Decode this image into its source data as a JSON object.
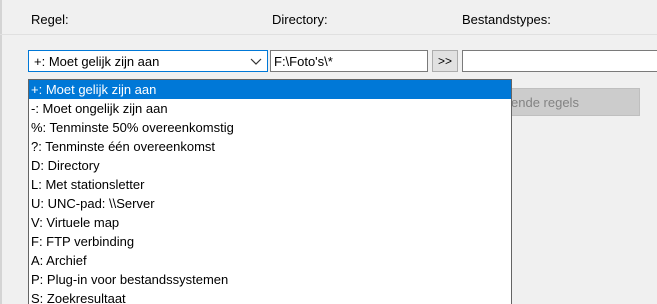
{
  "headers": {
    "regel": "Regel:",
    "directory": "Directory:",
    "bestandstypes": "Bestandstypes:"
  },
  "combo": {
    "value": "+: Moet gelijk zijn aan",
    "arrow_icon": "chevron-down-icon"
  },
  "directory_input": {
    "value": "F:\\Foto's\\*"
  },
  "arrow_button": {
    "label": ">>"
  },
  "types_input": {
    "value": ""
  },
  "partial_button": {
    "label": "ende regels"
  },
  "dropdown": {
    "selected_index": 0,
    "items": [
      "+: Moet gelijk zijn aan",
      "-: Moet ongelijk zijn aan",
      "%: Tenminste 50% overeenkomstig",
      "?: Tenminste één overeenkomst",
      "D: Directory",
      "L: Met stationsletter",
      "U: UNC-pad: \\\\Server",
      "V: Virtuele map",
      "F: FTP verbinding",
      "A: Archief",
      "P: Plug-in voor bestandssystemen",
      "S: Zoekresultaat"
    ]
  },
  "colors": {
    "selection": "#0078d7",
    "background": "#f0f0f0"
  }
}
